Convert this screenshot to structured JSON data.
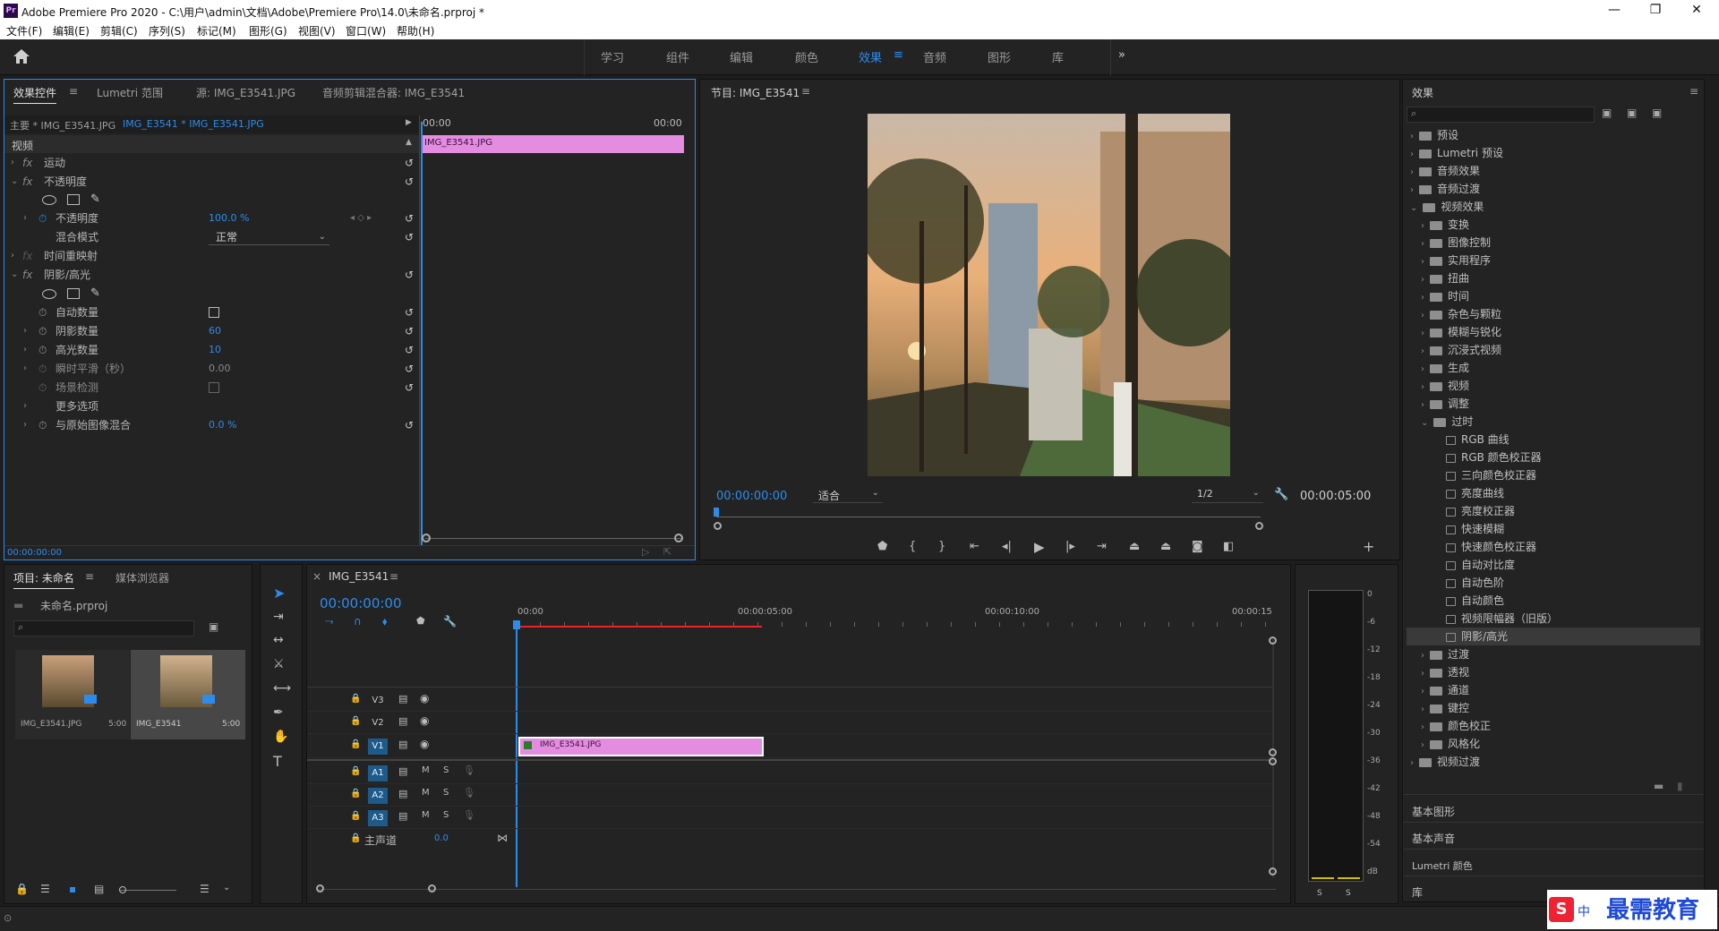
{
  "titlebar": {
    "app_icon": "Pr",
    "title": "Adobe Premiere Pro 2020 - C:\\用户\\admin\\文档\\Adobe\\Premiere Pro\\14.0\\未命名.prproj *",
    "minimize": "—",
    "maximize": "❐",
    "close": "✕"
  },
  "menu": [
    "文件(F)",
    "编辑(E)",
    "剪辑(C)",
    "序列(S)",
    "标记(M)",
    "图形(G)",
    "视图(V)",
    "窗口(W)",
    "帮助(H)"
  ],
  "workspaces": [
    "学习",
    "组件",
    "编辑",
    "颜色",
    "效果",
    "音频",
    "图形",
    "库"
  ],
  "workspace_active": "效果",
  "workspace_menu": "≡",
  "workspace_more": "»",
  "effect_controls": {
    "tabs": [
      "效果控件",
      "Lumetri 范围",
      "源: IMG_E3541.JPG",
      "音频剪辑混合器: IMG_E3541"
    ],
    "tab_menu": "≡",
    "master_label": "主要 * IMG_E3541.JPG",
    "sequence_label": "IMG_E3541 * IMG_E3541.JPG",
    "time_start": "00:00",
    "time_end": "00:00",
    "clip_name": "IMG_E3541.JPG",
    "section_video": "视频",
    "fx_motion": "运动",
    "fx_opacity": "不透明度",
    "opacity_label": "不透明度",
    "opacity_value": "100.0 %",
    "blend_label": "混合模式",
    "blend_value": "正常",
    "time_remap": "时间重映射",
    "fx_shadow": "阴影/高光",
    "auto_amount": "自动数量",
    "shadow_amount": "阴影数量",
    "shadow_value": "60",
    "highlight_amount": "高光数量",
    "highlight_value": "10",
    "temporal_smooth": "瞬时平滑（秒）",
    "temporal_value": "0.00",
    "scene_detect": "场景检测",
    "more_options": "更多选项",
    "blend_original": "与原始图像混合",
    "blend_original_value": "0.0 %",
    "timecode": "00:00:00:00",
    "fx_glyph": "fx",
    "reset_glyph": "↺"
  },
  "program": {
    "title": "节目: IMG_E3541",
    "timecode": "00:00:00:00",
    "fit": "适合",
    "resolution": "1/2",
    "duration": "00:00:05:00",
    "controls": [
      "marker",
      "in",
      "out",
      "go-in",
      "step-back",
      "play",
      "step-fwd",
      "go-out",
      "lift",
      "extract",
      "export-frame",
      "compare",
      "add"
    ]
  },
  "project": {
    "tabs": [
      "项目: 未命名",
      "媒体浏览器"
    ],
    "file": "未命名.prproj",
    "items": [
      {
        "name": "IMG_E3541.JPG",
        "duration": "5:00"
      },
      {
        "name": "IMG_E3541",
        "duration": "5:00"
      }
    ]
  },
  "timeline": {
    "close": "×",
    "tab": "IMG_E3541",
    "timecode": "00:00:00:00",
    "ruler": [
      "00:00",
      "00:00:05:00",
      "00:00:10:00",
      "00:00:15"
    ],
    "video_tracks": [
      "V3",
      "V2",
      "V1"
    ],
    "audio_tracks": [
      "A1",
      "A2",
      "A3"
    ],
    "master": "主声道",
    "master_value": "0.0",
    "clip": "IMG_E3541.JPG",
    "mute": "M",
    "solo": "S"
  },
  "meter": {
    "scale": [
      "0",
      "-6",
      "-12",
      "-18",
      "-24",
      "-30",
      "-36",
      "-42",
      "-48",
      "-54",
      "dB"
    ],
    "solo": [
      "S",
      "S"
    ]
  },
  "effects_panel": {
    "title": "效果",
    "menu": "≡",
    "top_items": [
      "预设",
      "Lumetri 预设",
      "音频效果",
      "音频过渡",
      "视频效果"
    ],
    "video_effects": [
      "变换",
      "图像控制",
      "实用程序",
      "扭曲",
      "时间",
      "杂色与颗粒",
      "模糊与锐化",
      "沉浸式视频",
      "生成",
      "视频",
      "调整",
      "过时"
    ],
    "obsolete_items": [
      "RGB 曲线",
      "RGB 颜色校正器",
      "三向颜色校正器",
      "亮度曲线",
      "亮度校正器",
      "快速模糊",
      "快速颜色校正器",
      "自动对比度",
      "自动色阶",
      "自动颜色",
      "视频限幅器（旧版）",
      "阴影/高光"
    ],
    "after_items": [
      "过渡",
      "透视",
      "通道",
      "键控",
      "颜色校正",
      "风格化"
    ],
    "video_transitions": "视频过渡",
    "panels": [
      "基本图形",
      "基本声音",
      "Lumetri 颜色",
      "库"
    ]
  },
  "watermark": {
    "s": "S",
    "zh": "中",
    "brand": "最需教育"
  }
}
